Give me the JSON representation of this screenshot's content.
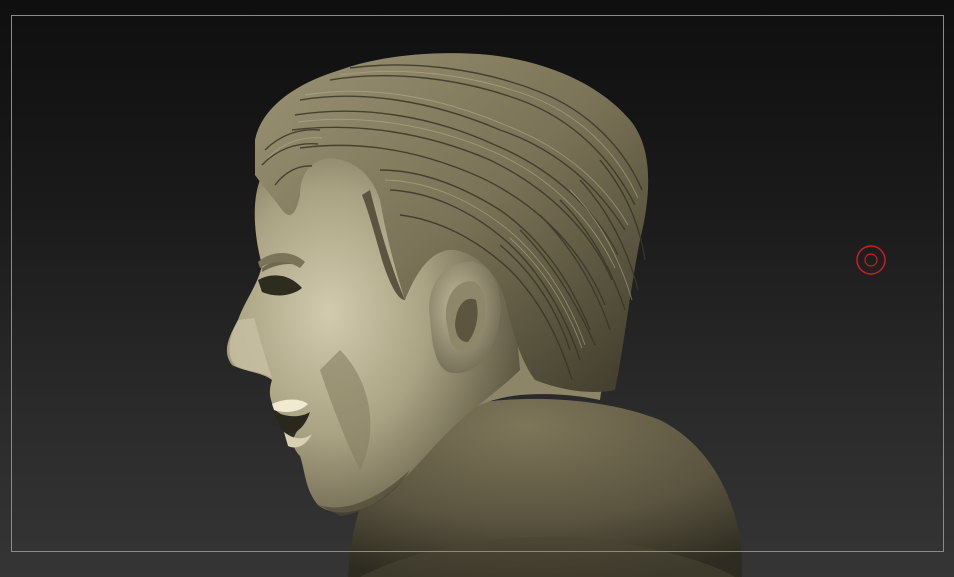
{
  "canvas": {
    "background_top": "#0f0f0f",
    "background_bottom": "#353535",
    "frame_color": "#8a8a8a"
  },
  "model": {
    "subject": "sculpted-head-bust",
    "material_color": "#8c8466",
    "highlight_color": "#bdb596",
    "shadow_color": "#3a3626"
  },
  "cursor": {
    "icon": "brush-cursor-icon",
    "color": "#cc1f1f"
  }
}
